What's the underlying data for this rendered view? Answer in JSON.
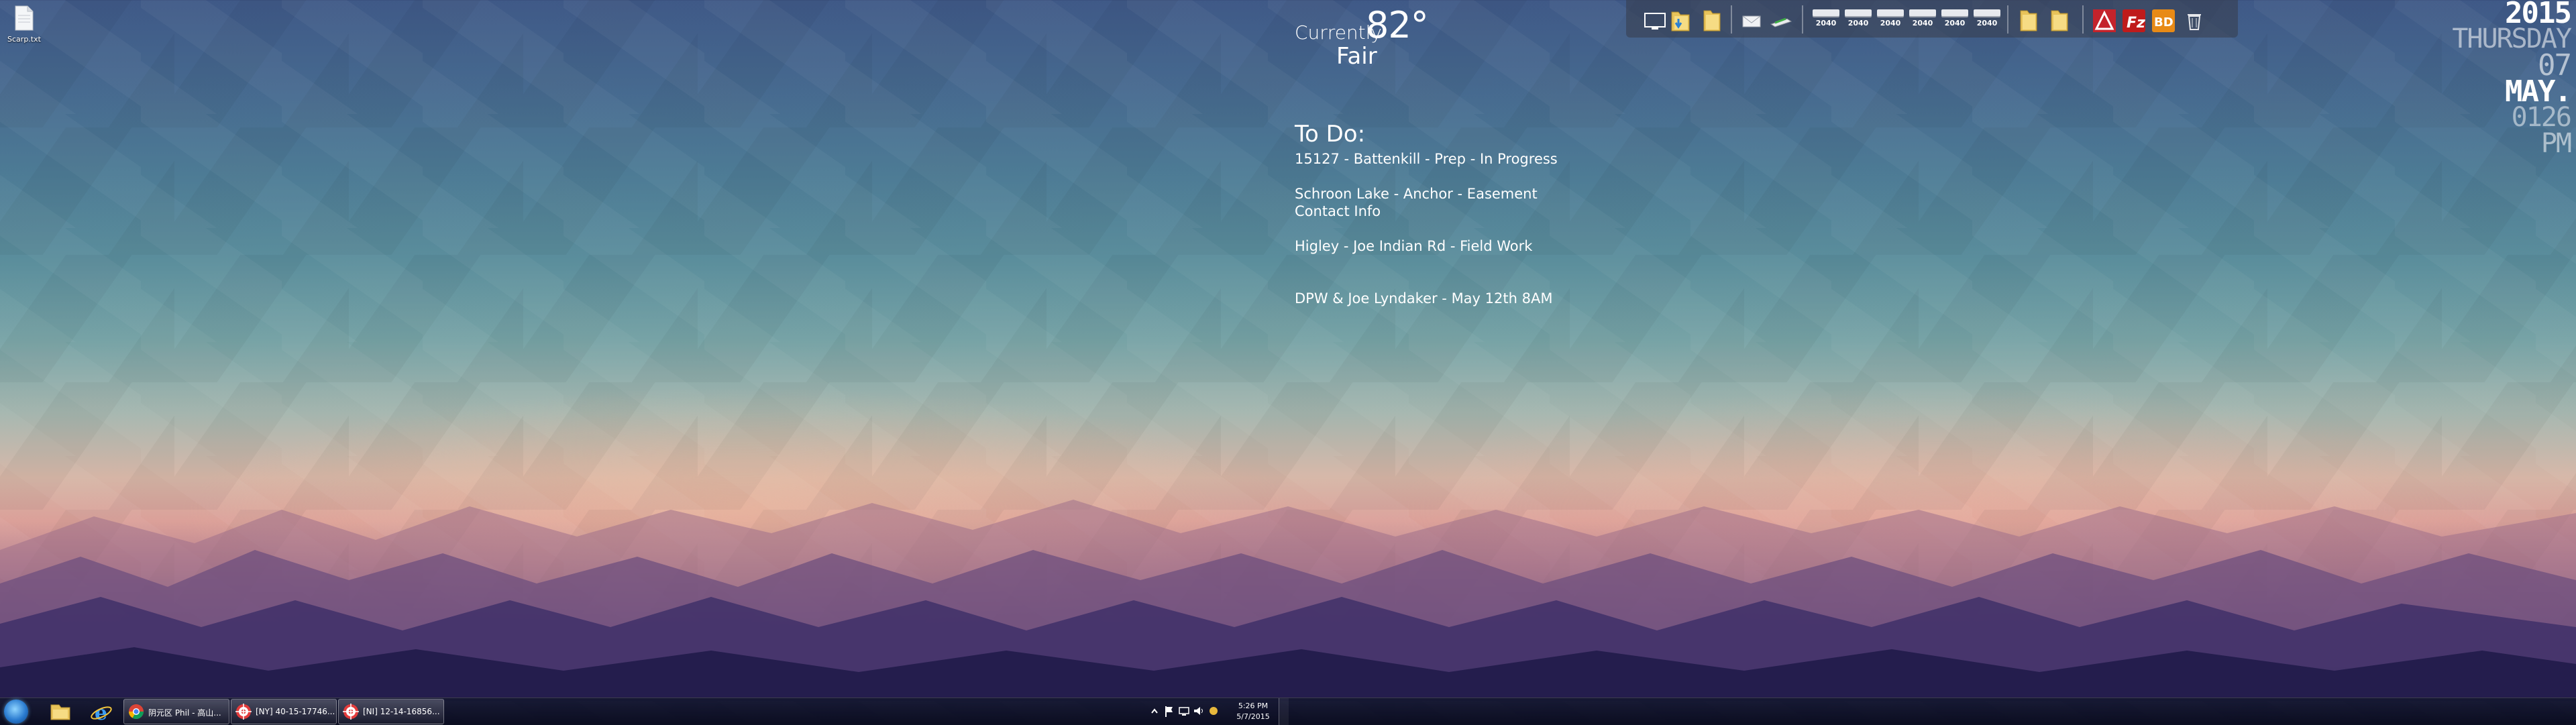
{
  "desktop": {
    "icons": [
      {
        "label": "Scarp.txt",
        "icon": "text-file-icon"
      }
    ]
  },
  "weather": {
    "prefix": "Currently",
    "temperature": "82°",
    "condition": "Fair"
  },
  "todo": {
    "title": "To Do:",
    "items": [
      "15127 - Battenkill - Prep - In Progress",
      "Schroon Lake - Anchor - Easement",
      "Contact Info",
      "Higley - Joe Indian Rd - Field Work",
      "DPW & Joe Lyndaker - May 12th 8AM"
    ]
  },
  "dock": {
    "icons": [
      "monitor-icon",
      "folder-download-icon",
      "folder-icon",
      "mail-icon",
      "scanner-icon",
      "folder-icon",
      "folder-icon",
      "autocad-icon",
      "filezilla-icon",
      "bd-icon",
      "recycle-bin-icon"
    ],
    "year_labels": [
      "2040",
      "2040",
      "2040",
      "2040",
      "2040",
      "2040"
    ]
  },
  "clock": {
    "year": "2015",
    "weekday": "THURSDAY",
    "day": "07",
    "month": "MAY.",
    "time": "0126",
    "ampm": "PM"
  },
  "taskbar": {
    "pinned": [
      "file-explorer-icon",
      "internet-explorer-icon"
    ],
    "tasks": [
      {
        "label": "阴元区 Phil - 高山...",
        "icon": "chrome-icon"
      },
      {
        "label": "[NY] 40-15-17746...",
        "icon": "target-icon"
      },
      {
        "label": "[NI] 12-14-16856...",
        "icon": "target-icon"
      }
    ],
    "tray": {
      "time": "5:26 PM",
      "date": "5/7/2015"
    }
  },
  "colors": {
    "sky_top": "#3f5987",
    "horizon": "#dba099",
    "ground": "#201b47"
  }
}
